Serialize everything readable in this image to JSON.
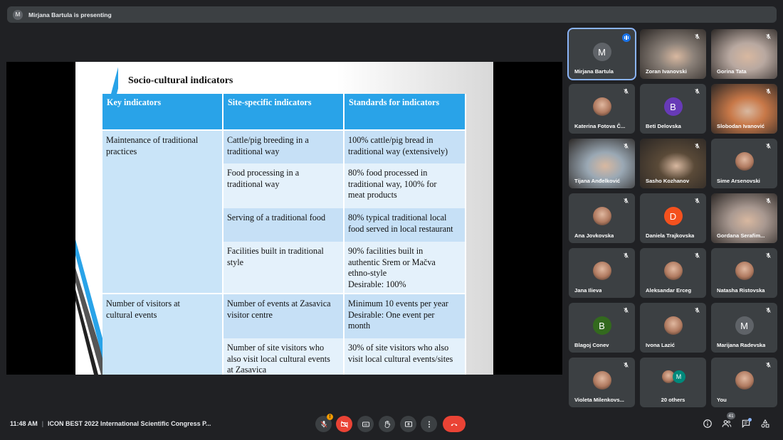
{
  "presenter_banner": {
    "avatar_letter": "M",
    "text": "Mirjana Bartula is presenting"
  },
  "slide": {
    "title": "Socio-cultural indicators",
    "headers": [
      "Key indicators",
      "Site-specific indicators",
      "Standards for indicators"
    ],
    "groups": [
      {
        "key": [
          "Maintenance of traditional",
          "practices"
        ],
        "rows": [
          {
            "site": [
              "Cattle/pig breeding in a",
              "traditional way"
            ],
            "std": [
              "100% cattle/pig bread in",
              "traditional way (extensively)"
            ]
          },
          {
            "site": [
              "Food processing in a",
              "traditional way"
            ],
            "std": [
              "80% food processed in",
              "traditional way, 100% for",
              "meat products"
            ]
          },
          {
            "site": [
              "Serving of a traditional food"
            ],
            "std": [
              "80% typical traditional local",
              "food served in local restaurant"
            ]
          },
          {
            "site": [
              "Facilities built in traditional",
              "style"
            ],
            "std": [
              "90% facilities built in",
              "authentic Srem or Mačva",
              "ethno-style",
              "Desirable: 100%"
            ]
          }
        ]
      },
      {
        "key": [
          "Number of visitors at",
          "cultural events"
        ],
        "rows": [
          {
            "site": [
              "Number of events at Zasavica",
              "visitor centre"
            ],
            "std": [
              "Minimum 10 events per year",
              "Desirable: One event per",
              "month"
            ]
          },
          {
            "site": [
              "Number of site visitors who",
              "also visit local cultural events",
              "at Zasavica"
            ],
            "std": [
              "30% of site visitors who also",
              "visit local cultural events/sites"
            ]
          }
        ]
      }
    ]
  },
  "participants": [
    {
      "name": "Mirjana Bartula",
      "avatar_letter": "M",
      "avatar_color": "#5f6368",
      "kind": "letter",
      "speaking": true
    },
    {
      "name": "Zoran Ivanovski",
      "kind": "video",
      "video_tone": "#8a8078"
    },
    {
      "name": "Gorina Tata",
      "kind": "video",
      "video_tone": "#b8a8a0"
    },
    {
      "name": "Katerina Fotova Č...",
      "kind": "photo"
    },
    {
      "name": "Beti Delovska",
      "avatar_letter": "B",
      "avatar_color": "#673ab7",
      "kind": "letter"
    },
    {
      "name": "Slobodan Ivanović",
      "kind": "video",
      "video_tone": "#c87848"
    },
    {
      "name": "Tijana Anđelković",
      "kind": "video",
      "video_tone": "#9aa8b4"
    },
    {
      "name": "Sasho Kozhanov",
      "kind": "video",
      "video_tone": "#5a4a38"
    },
    {
      "name": "Sime Arsenovski",
      "kind": "photo"
    },
    {
      "name": "Ana Jovkovska",
      "kind": "photo"
    },
    {
      "name": "Daniela Trajkovska",
      "avatar_letter": "D",
      "avatar_color": "#f4511e",
      "kind": "letter"
    },
    {
      "name": "Gordana Serafim...",
      "kind": "video",
      "video_tone": "#a89890"
    },
    {
      "name": "Jana Ilieva",
      "kind": "photo"
    },
    {
      "name": "Aleksandar Erceg",
      "kind": "photo"
    },
    {
      "name": "Natasha Ristovska",
      "kind": "photo"
    },
    {
      "name": "Blagoj Conev",
      "avatar_letter": "B",
      "avatar_color": "#33691e",
      "kind": "letter"
    },
    {
      "name": "Ivona Lazić",
      "kind": "photo"
    },
    {
      "name": "Marijana Radevska",
      "avatar_letter": "M",
      "avatar_color": "#5f6368",
      "kind": "letter"
    },
    {
      "name": "Violeta Milenkovs...",
      "kind": "photo"
    },
    {
      "name": "20 others",
      "kind": "others",
      "avatar_letter": "M"
    },
    {
      "name": "You",
      "kind": "photo"
    }
  ],
  "bottom": {
    "time": "11:48 AM",
    "meeting_title": "ICON BEST 2022 International Scientific Congress P...",
    "mic_badge": "!",
    "people_count": "41"
  },
  "colors": {
    "accent": "#8ab4f8",
    "hangup": "#ea4335",
    "header_blue": "#29a3e8"
  }
}
